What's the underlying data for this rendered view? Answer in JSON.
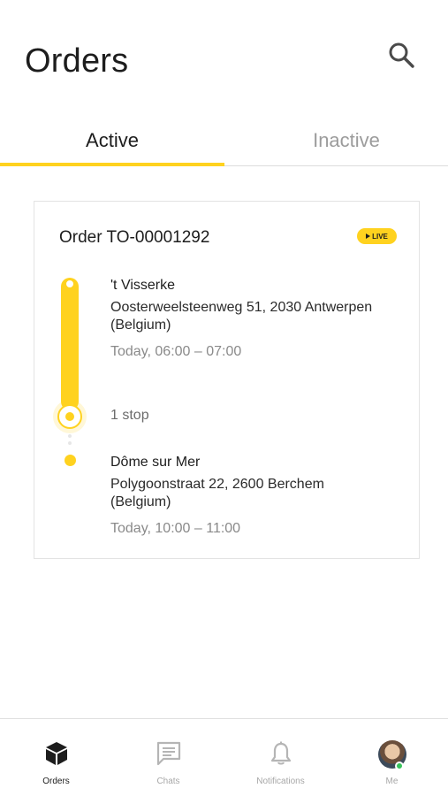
{
  "header": {
    "title": "Orders",
    "search_icon": "search-icon"
  },
  "tabs": [
    {
      "label": "Active",
      "selected": true
    },
    {
      "label": "Inactive",
      "selected": false
    }
  ],
  "colors": {
    "accent": "#ffd21f",
    "online": "#35c35a"
  },
  "order": {
    "title": "Order TO-00001292",
    "badge": "LIVE",
    "pickup": {
      "name": "'t Visserke",
      "address_line1": "Oosterweelsteenweg 51, 2030 Antwerpen",
      "address_line2": "(Belgium)",
      "time": "Today, 06:00 – 07:00"
    },
    "stops": "1 stop",
    "dropoff": {
      "name": "Dôme sur Mer",
      "address_line1": "Polygoonstraat 22, 2600 Berchem",
      "address_line2": "(Belgium)",
      "time": "Today, 10:00 – 11:00"
    }
  },
  "bottom_nav": [
    {
      "label": "Orders",
      "icon": "box-icon",
      "active": true
    },
    {
      "label": "Chats",
      "icon": "chat-icon",
      "active": false
    },
    {
      "label": "Notifications",
      "icon": "bell-icon",
      "active": false
    },
    {
      "label": "Me",
      "icon": "avatar",
      "active": false
    }
  ]
}
